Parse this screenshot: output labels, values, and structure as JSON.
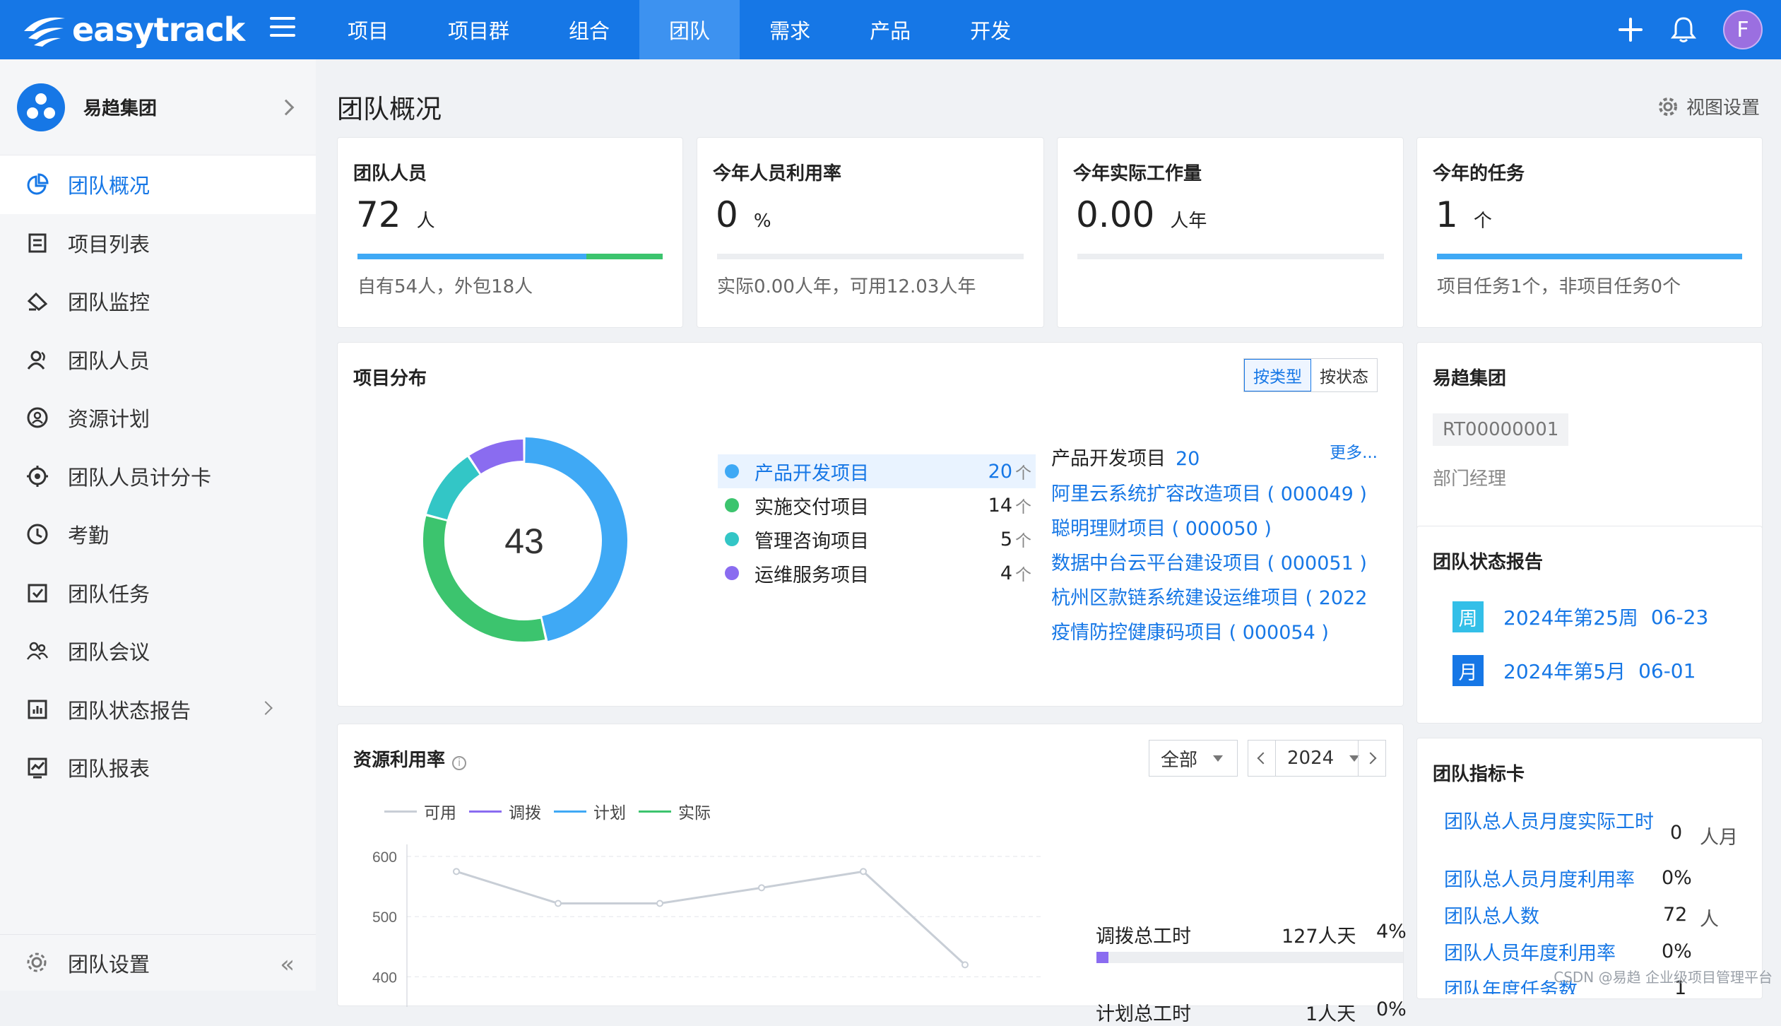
{
  "app": {
    "name": "easytrack",
    "colors": {
      "brand": "#1677e6",
      "green": "#3cc46e",
      "teal": "#33c6c6",
      "purple": "#8a6cf0",
      "blue_light": "#3fa9f5"
    }
  },
  "topnav": {
    "items": [
      {
        "label": "项目",
        "active": false
      },
      {
        "label": "项目群",
        "active": false
      },
      {
        "label": "组合",
        "active": false
      },
      {
        "label": "团队",
        "active": true
      },
      {
        "label": "需求",
        "active": false
      },
      {
        "label": "产品",
        "active": false
      },
      {
        "label": "开发",
        "active": false
      }
    ],
    "avatar_letter": "F"
  },
  "sidebar": {
    "org_name": "易趋集团",
    "items": [
      {
        "label": "团队概况",
        "icon": "pie-chart-icon",
        "active": true
      },
      {
        "label": "项目列表",
        "icon": "list-icon"
      },
      {
        "label": "团队监控",
        "icon": "monitor-icon"
      },
      {
        "label": "团队人员",
        "icon": "people-icon"
      },
      {
        "label": "资源计划",
        "icon": "resource-icon"
      },
      {
        "label": "团队人员计分卡",
        "icon": "target-icon"
      },
      {
        "label": "考勤",
        "icon": "clock-icon"
      },
      {
        "label": "团队任务",
        "icon": "task-icon"
      },
      {
        "label": "团队会议",
        "icon": "meeting-icon"
      },
      {
        "label": "团队状态报告",
        "icon": "report-icon",
        "has_submenu": true
      },
      {
        "label": "团队报表",
        "icon": "chart-icon"
      }
    ],
    "settings_label": "团队设置"
  },
  "page": {
    "title": "团队概况",
    "view_settings": "视图设置"
  },
  "kpis": [
    {
      "title": "团队人员",
      "value": "72",
      "unit": "人",
      "sub": "自有54人，外包18人",
      "bar": [
        {
          "pct": 75,
          "color": "#3fa9f5"
        },
        {
          "pct": 25,
          "color": "#3cc46e"
        }
      ]
    },
    {
      "title": "今年人员利用率",
      "value": "0",
      "unit": "%",
      "sub": "实际0.00人年，可用12.03人年",
      "bar": []
    },
    {
      "title": "今年实际工作量",
      "value": "0.00",
      "unit": "人年",
      "sub": "",
      "bar": []
    },
    {
      "title": "今年的任务",
      "value": "1",
      "unit": "个",
      "sub": "项目任务1个，非项目任务0个",
      "bar": [
        {
          "pct": 100,
          "color": "#3fa9f5"
        }
      ]
    }
  ],
  "project_dist": {
    "title": "项目分布",
    "toggle": [
      "按类型",
      "按状态"
    ],
    "total": "43",
    "legend": [
      {
        "label": "产品开发项目",
        "count": 20,
        "unit": "个",
        "color": "#3fa9f5",
        "highlight": true
      },
      {
        "label": "实施交付项目",
        "count": 14,
        "unit": "个",
        "color": "#3cc46e"
      },
      {
        "label": "管理咨询项目",
        "count": 5,
        "unit": "个",
        "color": "#33c6c6"
      },
      {
        "label": "运维服务项目",
        "count": 4,
        "unit": "个",
        "color": "#8a6cf0"
      }
    ],
    "selected_type": "产品开发项目",
    "selected_count": "20",
    "more": "更多...",
    "projects": [
      "阿里云系统扩容改造项目 ( 000049 )",
      "聪明理财项目 ( 000050 )",
      "数据中台云平台建设项目 ( 000051 )",
      "杭州区款链系统建设运维项目 ( 2022...",
      "疫情防控健康码项目 ( 000054 )"
    ]
  },
  "org_card": {
    "name": "易趋集团",
    "code": "RT00000001",
    "role": "部门经理"
  },
  "status_report": {
    "title": "团队状态报告",
    "rows": [
      {
        "badge": "周",
        "text": "2024年第25周",
        "date": "06-23",
        "color": "#33bfe8"
      },
      {
        "badge": "月",
        "text": "2024年第5月",
        "date": "06-01",
        "color": "#1677e6"
      }
    ]
  },
  "indicators": {
    "title": "团队指标卡",
    "rows": [
      {
        "name": "团队总人员月度实际工时",
        "value": "0",
        "unit": "人月"
      },
      {
        "name": "团队总人员月度利用率",
        "value": "0%",
        "unit": ""
      },
      {
        "name": "团队总人数",
        "value": "72",
        "unit": "人"
      },
      {
        "name": "团队人员年度利用率",
        "value": "0%",
        "unit": ""
      },
      {
        "name": "团队年度任务数",
        "value": "1",
        "unit": ""
      }
    ]
  },
  "resource": {
    "title": "资源利用率",
    "filter": "全部",
    "year": "2024",
    "legend": [
      {
        "name": "可用",
        "color": "#c8ced6"
      },
      {
        "name": "调拨",
        "color": "#8a6cf0"
      },
      {
        "name": "计划",
        "color": "#3fa9f5"
      },
      {
        "name": "实际",
        "color": "#3cc46e"
      }
    ],
    "stats": [
      {
        "name": "调拨总工时",
        "value": "127人天",
        "pct": "4%",
        "fill": 0.04
      },
      {
        "name": "计划总工时",
        "value": "1人天",
        "pct": "0%",
        "fill": 0
      }
    ]
  },
  "chart_data": {
    "type": "line",
    "x": [
      1,
      2,
      3,
      4,
      5,
      6
    ],
    "series": [
      {
        "name": "可用",
        "values": [
          575,
          522,
          522,
          548,
          575,
          420
        ]
      }
    ],
    "y_ticks": [
      400,
      500,
      600
    ],
    "ylim": [
      350,
      620
    ],
    "grid": true,
    "legend": "top-left"
  },
  "watermark": "CSDN @易趋 企业级项目管理平台"
}
